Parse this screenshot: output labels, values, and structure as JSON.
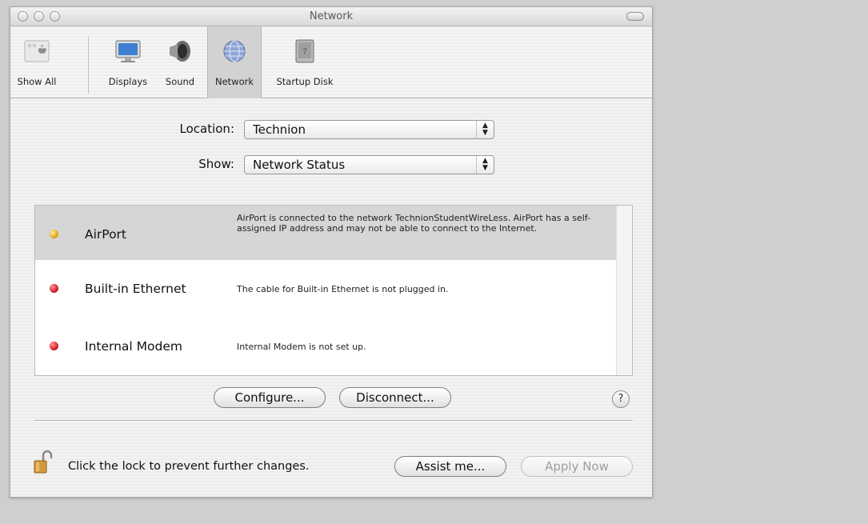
{
  "window": {
    "title": "Network"
  },
  "toolbar": {
    "items": [
      {
        "label": "Show All",
        "icon": "apple-icon"
      },
      {
        "label": "Displays",
        "icon": "display-icon"
      },
      {
        "label": "Sound",
        "icon": "speaker-icon"
      },
      {
        "label": "Network",
        "icon": "network-globe-icon",
        "selected": true
      },
      {
        "label": "Startup Disk",
        "icon": "hard-disk-icon"
      }
    ]
  },
  "location": {
    "label": "Location:",
    "value": "Technion"
  },
  "show": {
    "label": "Show:",
    "value": "Network Status"
  },
  "services": [
    {
      "name": "AirPort",
      "status_color": "#e2a51a",
      "description": "AirPort is connected to the network TechnionStudentWireLess. AirPort has a self-assigned IP address and may not be able to connect to the Internet."
    },
    {
      "name": "Built-in Ethernet",
      "status_color": "#d9202a",
      "description": "The cable for Built-in Ethernet is not plugged in."
    },
    {
      "name": "Internal Modem",
      "status_color": "#d9202a",
      "description": "Internal Modem is not set up."
    }
  ],
  "buttons": {
    "configure": "Configure...",
    "disconnect": "Disconnect...",
    "help": "?",
    "assist": "Assist me...",
    "apply": "Apply Now"
  },
  "lock": {
    "text": "Click the lock to prevent further changes."
  }
}
